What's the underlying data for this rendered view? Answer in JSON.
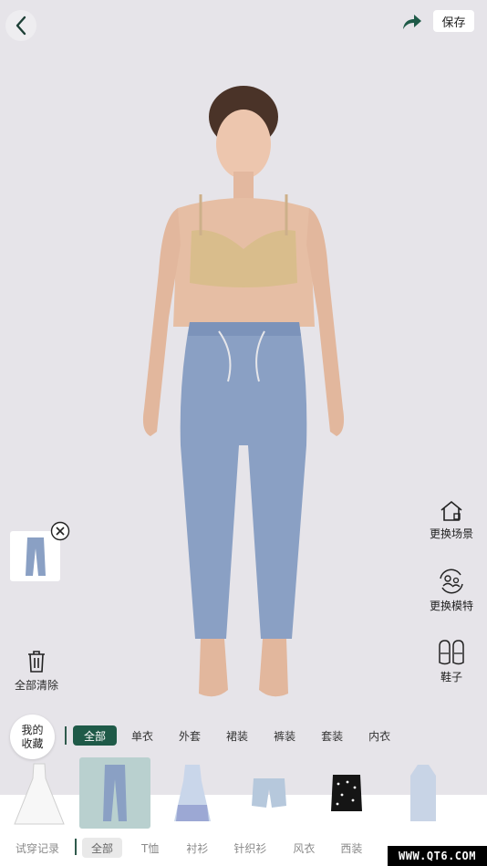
{
  "header": {
    "back_icon": "chevron-left-icon",
    "share_icon": "share-arrow-icon",
    "save_label": "保存"
  },
  "tools": [
    {
      "label": "更换场景",
      "icon": "house-icon"
    },
    {
      "label": "更换模特",
      "icon": "person-swap-icon"
    },
    {
      "label": "鞋子",
      "icon": "shoes-icon"
    }
  ],
  "left": {
    "clear_label": "全部清除",
    "clear_icon": "trash-icon",
    "close_icon": "close-circle-icon"
  },
  "favorites": {
    "line1": "我的",
    "line2": "收藏"
  },
  "categories": [
    "全部",
    "单衣",
    "外套",
    "裙装",
    "裤装",
    "套装",
    "内衣"
  ],
  "active_category": "全部",
  "bottom_tabs": [
    "试穿记录",
    "全部",
    "T恤",
    "衬衫",
    "针织衫",
    "风衣",
    "西装"
  ],
  "active_bottom_tab": "全部",
  "watermark": "WWW.QT6.COM",
  "colors": {
    "accent": "#1f5a48",
    "background": "#e6e4e9",
    "selected": "#b9d0cf"
  }
}
